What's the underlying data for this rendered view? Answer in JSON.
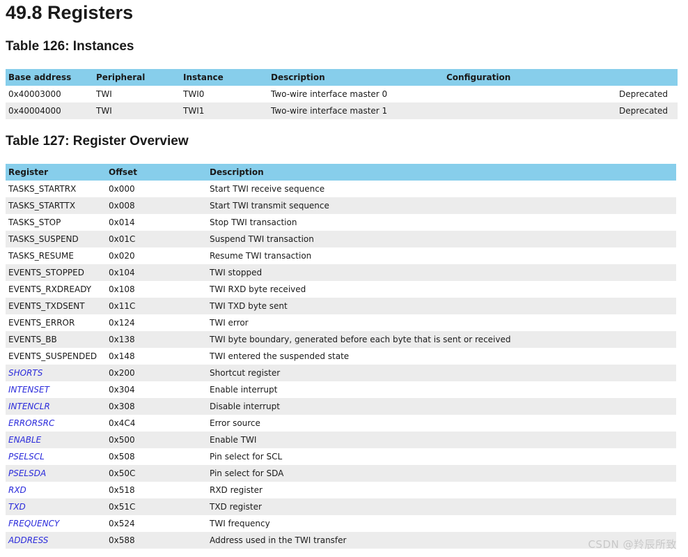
{
  "heading": "49.8 Registers",
  "table126": {
    "title": "Table 126: Instances",
    "headers": [
      "Base address",
      "Peripheral",
      "Instance",
      "Description",
      "Configuration"
    ],
    "rows": [
      {
        "base": "0x40003000",
        "peripheral": "TWI",
        "instance": "TWI0",
        "description": "Two-wire interface master 0",
        "configuration": "Deprecated"
      },
      {
        "base": "0x40004000",
        "peripheral": "TWI",
        "instance": "TWI1",
        "description": "Two-wire interface master 1",
        "configuration": "Deprecated"
      }
    ]
  },
  "table127": {
    "title": "Table 127: Register Overview",
    "headers": [
      "Register",
      "Offset",
      "Description"
    ],
    "rows": [
      {
        "register": "TASKS_STARTRX",
        "offset": "0x000",
        "description": "Start TWI receive sequence",
        "link": false
      },
      {
        "register": "TASKS_STARTTX",
        "offset": "0x008",
        "description": "Start TWI transmit sequence",
        "link": false
      },
      {
        "register": "TASKS_STOP",
        "offset": "0x014",
        "description": "Stop TWI transaction",
        "link": false
      },
      {
        "register": "TASKS_SUSPEND",
        "offset": "0x01C",
        "description": "Suspend TWI transaction",
        "link": false
      },
      {
        "register": "TASKS_RESUME",
        "offset": "0x020",
        "description": "Resume TWI transaction",
        "link": false
      },
      {
        "register": "EVENTS_STOPPED",
        "offset": "0x104",
        "description": "TWI stopped",
        "link": false
      },
      {
        "register": "EVENTS_RXDREADY",
        "offset": "0x108",
        "description": "TWI RXD byte received",
        "link": false
      },
      {
        "register": "EVENTS_TXDSENT",
        "offset": "0x11C",
        "description": "TWI TXD byte sent",
        "link": false
      },
      {
        "register": "EVENTS_ERROR",
        "offset": "0x124",
        "description": "TWI error",
        "link": false
      },
      {
        "register": "EVENTS_BB",
        "offset": "0x138",
        "description": "TWI byte boundary, generated before each byte that is sent or received",
        "link": false
      },
      {
        "register": "EVENTS_SUSPENDED",
        "offset": "0x148",
        "description": "TWI entered the suspended state",
        "link": false
      },
      {
        "register": "SHORTS",
        "offset": "0x200",
        "description": "Shortcut register",
        "link": true
      },
      {
        "register": "INTENSET",
        "offset": "0x304",
        "description": "Enable interrupt",
        "link": true
      },
      {
        "register": "INTENCLR",
        "offset": "0x308",
        "description": "Disable interrupt",
        "link": true
      },
      {
        "register": "ERRORSRC",
        "offset": "0x4C4",
        "description": "Error source",
        "link": true
      },
      {
        "register": "ENABLE",
        "offset": "0x500",
        "description": "Enable TWI",
        "link": true
      },
      {
        "register": "PSELSCL",
        "offset": "0x508",
        "description": "Pin select for SCL",
        "link": true
      },
      {
        "register": "PSELSDA",
        "offset": "0x50C",
        "description": "Pin select for SDA",
        "link": true
      },
      {
        "register": "RXD",
        "offset": "0x518",
        "description": "RXD register",
        "link": true
      },
      {
        "register": "TXD",
        "offset": "0x51C",
        "description": "TXD register",
        "link": true
      },
      {
        "register": "FREQUENCY",
        "offset": "0x524",
        "description": "TWI frequency",
        "link": true
      },
      {
        "register": "ADDRESS",
        "offset": "0x588",
        "description": "Address used in the TWI transfer",
        "link": true
      }
    ]
  },
  "watermark": "CSDN @羚辰所致",
  "colors": {
    "header_bg": "#87ceeb",
    "stripe": "#ececec",
    "link": "#2a2adb"
  }
}
